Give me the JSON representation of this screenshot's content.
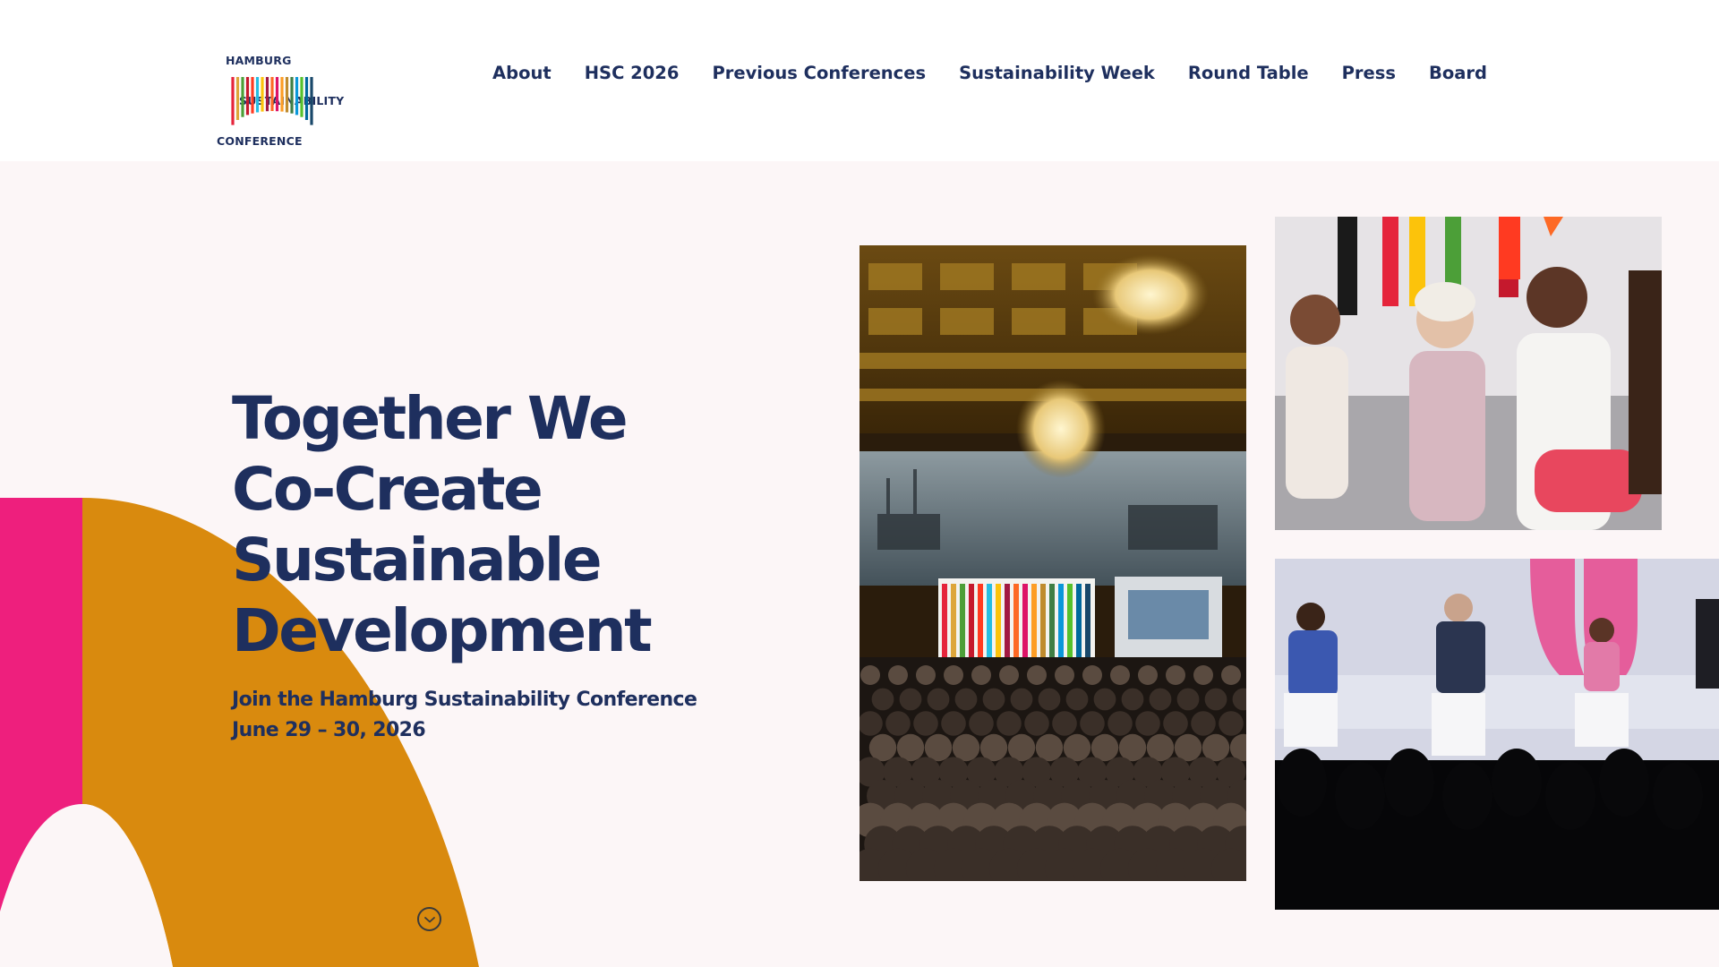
{
  "logo": {
    "lines": [
      "HAMBURG",
      "SUSTAINABILITY",
      "CONFERENCE"
    ],
    "stripe_colors": [
      "#e5243b",
      "#dda63a",
      "#4c9f38",
      "#c5192d",
      "#ff3a21",
      "#26bde2",
      "#fcc30b",
      "#a21942",
      "#fd6925",
      "#dd1367",
      "#fd9d24",
      "#bf8b2e",
      "#3f7e44",
      "#0a97d9",
      "#56c02b",
      "#00689d",
      "#19486a"
    ]
  },
  "nav": {
    "items": [
      "About",
      "HSC 2026",
      "Previous Conferences",
      "Sustainability Week",
      "Round Table",
      "Press",
      "Board"
    ]
  },
  "hero": {
    "title_lines": [
      "Together We",
      "Co-Create",
      "Sustainable",
      "Development"
    ],
    "subtitle": "Join the Hamburg Sustainability Conference",
    "dates": "June 29 – 30, 2026",
    "scroll_icon": "chevron-down-icon"
  },
  "colors": {
    "navy": "#1e2f5e",
    "background": "#fcf6f7",
    "pink": "#ee1f7d",
    "amber": "#d98a0e"
  }
}
